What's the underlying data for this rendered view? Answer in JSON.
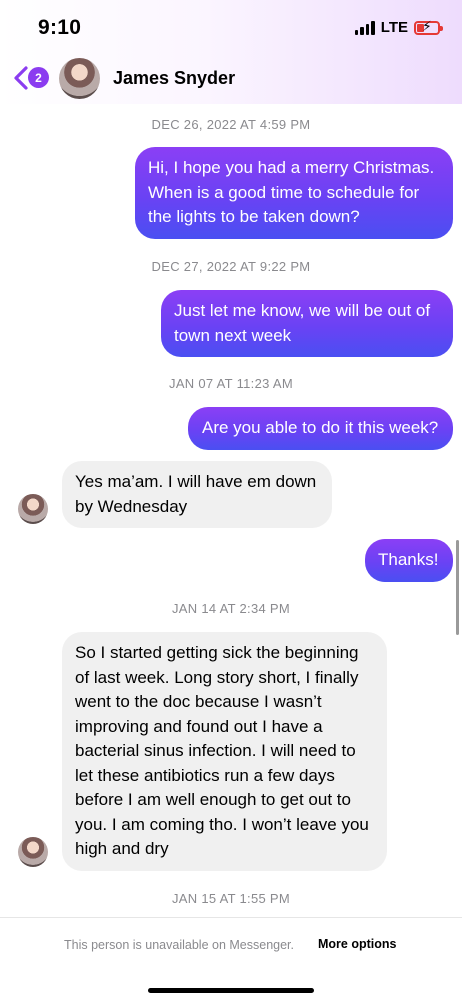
{
  "status_bar": {
    "time": "9:10",
    "network": "LTE"
  },
  "header": {
    "back_badge": "2",
    "contact_name": "James Snyder"
  },
  "conversation": {
    "timestamps": [
      "DEC 26, 2022 AT 4:59 PM",
      "DEC 27, 2022 AT 9:22 PM",
      "JAN 07 AT 11:23 AM",
      "JAN 14 AT 2:34 PM",
      "JAN 15 AT 1:55 PM"
    ],
    "messages": [
      {
        "direction": "outgoing",
        "text": "Hi, I hope you had a merry Christmas. When is a good time to schedule for the lights to be taken down?"
      },
      {
        "direction": "outgoing",
        "text": "Just let me know, we will be out of town next week"
      },
      {
        "direction": "outgoing",
        "text": "Are you able to do it this week?"
      },
      {
        "direction": "incoming",
        "text": "Yes ma’am. I will have em down by Wednesday"
      },
      {
        "direction": "outgoing",
        "text": "Thanks!"
      },
      {
        "direction": "incoming",
        "text": "So I started getting sick the beginning of last week. Long story short, I finally went to the doc because I wasn’t improving and found out I have a bacterial sinus infection. I will need to let these antibiotics run a few days before I am well enough to get out to you. I am coming tho. I won’t leave you high and dry"
      }
    ]
  },
  "footer": {
    "notice": "This person is unavailable on Messenger.",
    "more_options_label": "More options"
  },
  "colors": {
    "outgoing_bubble_top": "#8b3ff5",
    "outgoing_bubble_bottom": "#4a4ff2",
    "incoming_bubble": "#f0f0f0",
    "accent": "#8b3cf0",
    "timestamp_text": "#8a8a8e"
  },
  "icons": {
    "back": "chevron-left-icon",
    "signal": "signal-bars-icon",
    "battery": "battery-charging-icon"
  }
}
